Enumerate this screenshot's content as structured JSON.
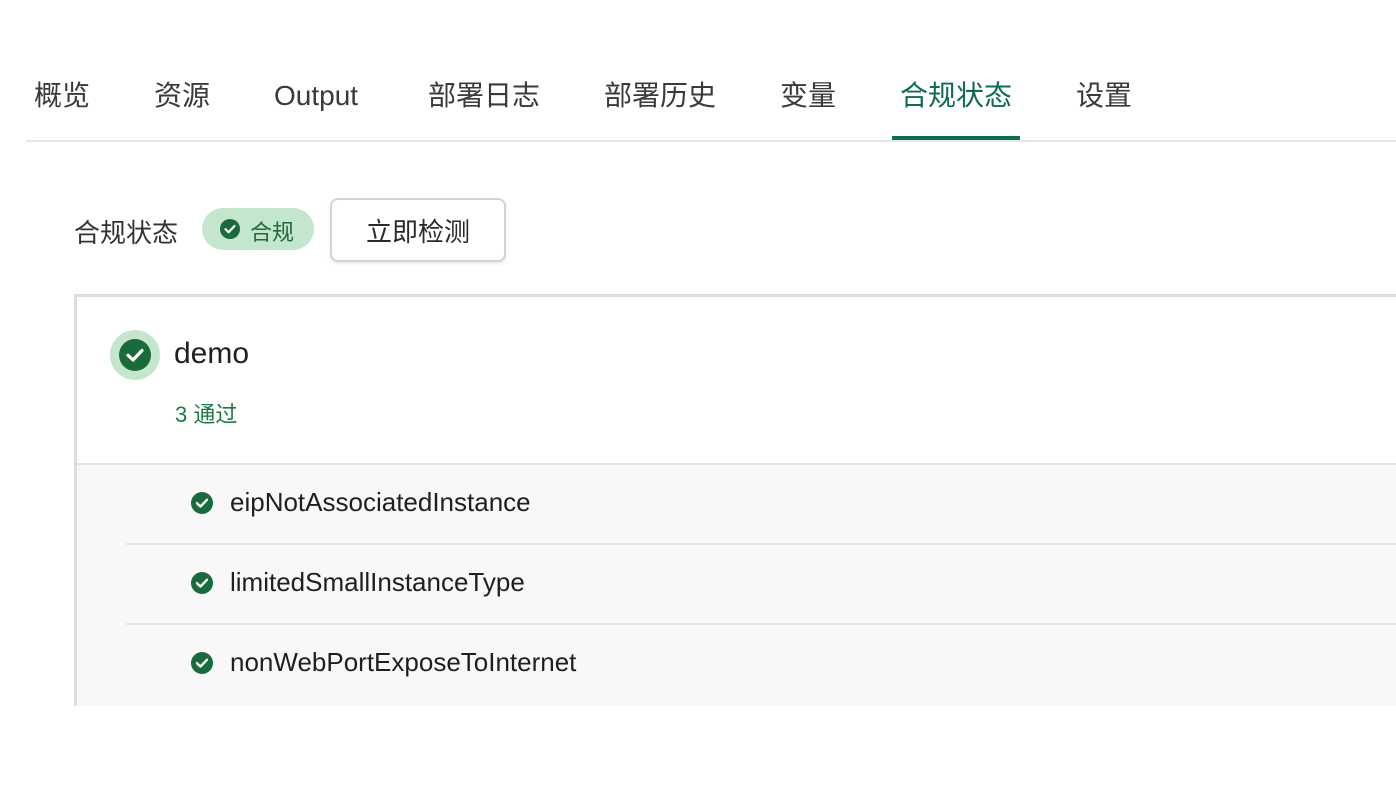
{
  "tabs": [
    {
      "label": "概览"
    },
    {
      "label": "资源"
    },
    {
      "label": "Output"
    },
    {
      "label": "部署日志"
    },
    {
      "label": "部署历史"
    },
    {
      "label": "变量"
    },
    {
      "label": "合规状态",
      "active": true
    },
    {
      "label": "设置"
    }
  ],
  "compliance": {
    "label": "合规状态",
    "badge_text": "合规",
    "badge_icon": "check-circle-icon",
    "check_button_label": "立即检测"
  },
  "panel": {
    "name": "demo",
    "summary": "3 通过",
    "status_icon": "check-circle-icon",
    "rules": [
      {
        "name": "eipNotAssociatedInstance",
        "status": "passed"
      },
      {
        "name": "limitedSmallInstanceType",
        "status": "passed"
      },
      {
        "name": "nonWebPortExposeToInternet",
        "status": "passed"
      }
    ]
  },
  "colors": {
    "accent": "#0f6b55",
    "pass_green": "#1d6a3a",
    "pass_bg": "#c4e6cd"
  }
}
